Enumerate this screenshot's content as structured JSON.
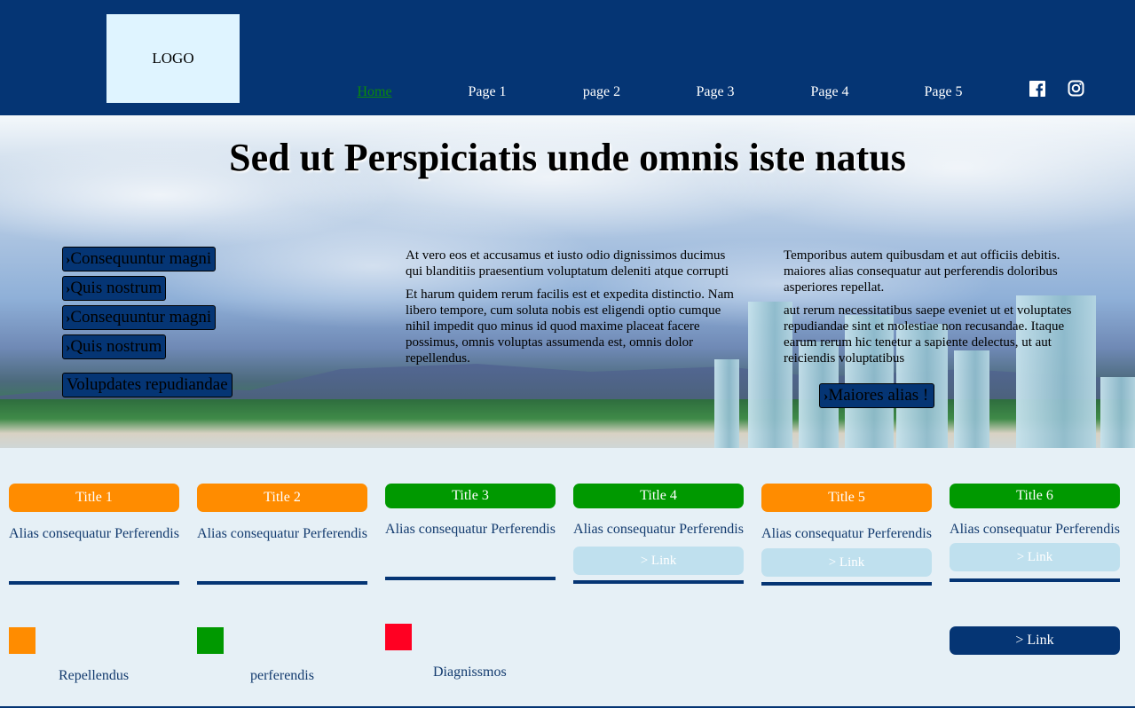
{
  "header": {
    "logo": "LOGO",
    "nav": [
      "Home",
      "Page 1",
      "page 2",
      "Page 3",
      "Page 4",
      "Page 5"
    ],
    "social_icons": [
      "facebook-icon",
      "instagram-icon"
    ]
  },
  "hero": {
    "title": "Sed ut Perspiciatis unde omnis iste natus",
    "buttons": [
      "Consequuntur magni",
      "Quis nostrum",
      "Consequuntur magni",
      "Quis nostrum"
    ],
    "button_plain": "Volupdates repudiandae",
    "col1": [
      "At vero eos et accusamus et iusto odio dignissimos ducimus qui blanditiis praesentium voluptatum deleniti atque corrupti",
      "Et harum quidem rerum facilis est et expedita distinctio. Nam libero tempore, cum soluta nobis est eligendi optio cumque nihil impedit quo minus id quod maxime placeat facere possimus, omnis voluptas assumenda est, omnis dolor repellendus."
    ],
    "col2": [
      "Temporibus autem quibusdam et aut officiis debitis. maiores alias consequatur aut perferendis doloribus asperiores repellat.",
      "aut rerum necessitatibus saepe eveniet ut et voluptates repudiandae sint et molestiae non recusandae. Itaque earum rerum hic tenetur a sapiente delectus, ut aut reiciendis voluptatibus"
    ],
    "cta": "Maiores alias !"
  },
  "cards": [
    {
      "title": "Title 1",
      "desc": "Alias consequatur Perferendis",
      "color": "#ff8c00"
    },
    {
      "title": "Title 2",
      "desc": "Alias consequatur Perferendis",
      "color": "#ff8c00"
    },
    {
      "title": "Title 3",
      "desc": "Alias consequatur Perferendis",
      "color": "#009900"
    },
    {
      "title": "Title 4",
      "desc": "Alias consequatur Perferendis",
      "color": "#009900",
      "link": "> Link"
    },
    {
      "title": "Title 5",
      "desc": "Alias consequatur Perferendis",
      "color": "#ff8c00",
      "link": "> Link"
    },
    {
      "title": "Title 6",
      "desc": "Alias consequatur Perferendis",
      "color": "#009900",
      "link": "> Link"
    }
  ],
  "legend": [
    {
      "label": "Repellendus",
      "color": "#ff8c00"
    },
    {
      "label": "perferendis",
      "color": "#009900"
    },
    {
      "label": "Diagnissmos",
      "color": "#ff0022"
    }
  ],
  "bottom_button": "> Link"
}
